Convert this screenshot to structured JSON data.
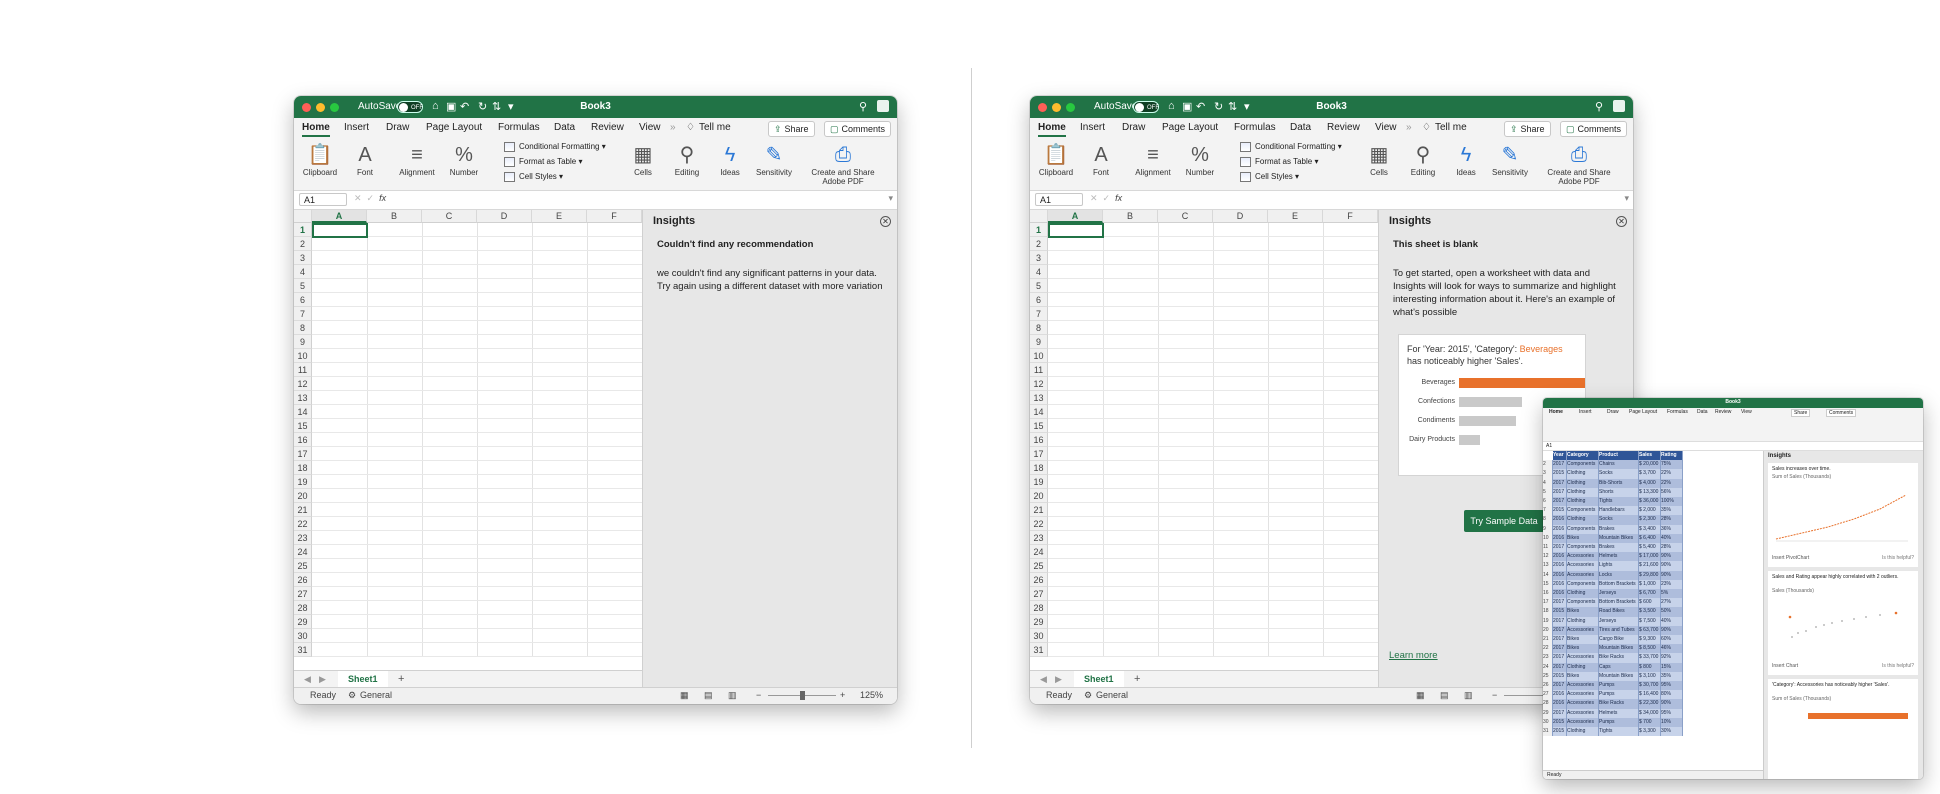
{
  "window": {
    "autosave_label": "AutoSave",
    "autosave_state": "OFF",
    "title": "Book3"
  },
  "tabs": [
    "Home",
    "Insert",
    "Draw",
    "Page Layout",
    "Formulas",
    "Data",
    "Review",
    "View"
  ],
  "tell_me": "Tell me",
  "share": "Share",
  "comments": "Comments",
  "ribbon": {
    "clipboard": "Clipboard",
    "font": "Font",
    "alignment": "Alignment",
    "number": "Number",
    "conditional_formatting": "Conditional Formatting",
    "format_as_table": "Format as Table",
    "cell_styles": "Cell Styles",
    "cells": "Cells",
    "editing": "Editing",
    "ideas": "Ideas",
    "sensitivity": "Sensitivity",
    "adobe_line1": "Create and Share",
    "adobe_line2": "Adobe PDF"
  },
  "name_box": "A1",
  "fx": "fx",
  "columns": [
    "A",
    "B",
    "C",
    "D",
    "E",
    "F"
  ],
  "rows": [
    "1",
    "2",
    "3",
    "4",
    "5",
    "6",
    "7",
    "8",
    "9",
    "10",
    "11",
    "12",
    "13",
    "14",
    "15",
    "16",
    "17",
    "18",
    "19",
    "20",
    "21",
    "22",
    "23",
    "24",
    "25",
    "26",
    "27",
    "28",
    "29",
    "30",
    "31"
  ],
  "sheet_tab": "Sheet1",
  "status": {
    "ready": "Ready",
    "general": "General",
    "zoom": "125%"
  },
  "left_panel": {
    "title": "Insights",
    "heading": "Couldn't find any recommendation",
    "body": "we couldn't find any significant patterns in your data. Try again using a different dataset with more variation"
  },
  "right_panel": {
    "title": "Insights",
    "heading": "This sheet is blank",
    "body": "To get started, open a worksheet with data and Insights will look for ways to summarize and highlight interesting information about it. Here's an example of what's possible",
    "example_prefix": "For 'Year: 2015', 'Category':",
    "example_highlight": "Beverages",
    "example_suffix": "has noticeably higher 'Sales'.",
    "bars": [
      {
        "label": "Beverages",
        "value": 1.0
      },
      {
        "label": "Confections",
        "value": 0.5
      },
      {
        "label": "Condiments",
        "value": 0.45
      },
      {
        "label": "Dairy Products",
        "value": 0.17
      }
    ],
    "try_button": "Try Sample Data",
    "learn_more": "Learn more"
  },
  "inset": {
    "insights_title": "Insights",
    "card1_text": "Sales increases over time.",
    "card1_sub": "Sum of Sales (Thousands)",
    "card1_link": "Insert PivotChart",
    "card2_text": "Sales and Rating appear highly correlated with 2 outliers.",
    "card2_sub": "Sales (Thousands)",
    "card2_link": "Insert Chart",
    "card3_text": "'Category': Accessories has noticeably higher 'Sales'.",
    "card3_sub": "Sum of Sales (Thousands)",
    "helpful": "Is this helpful?",
    "headers": [
      "Year",
      "Category",
      "Product",
      "Sales",
      "Rating"
    ],
    "table": [
      [
        "2017",
        "Components",
        "Chains",
        "$ 20,000",
        "75%"
      ],
      [
        "2015",
        "Clothing",
        "Socks",
        "$ 3,700",
        "22%"
      ],
      [
        "2017",
        "Clothing",
        "Bib-Shorts",
        "$ 4,000",
        "22%"
      ],
      [
        "2017",
        "Clothing",
        "Shorts",
        "$ 13,300",
        "56%"
      ],
      [
        "2017",
        "Clothing",
        "Tights",
        "$ 36,000",
        "100%"
      ],
      [
        "2015",
        "Components",
        "Handlebars",
        "$ 2,000",
        "35%"
      ],
      [
        "2016",
        "Clothing",
        "Socks",
        "$ 2,300",
        "28%"
      ],
      [
        "2016",
        "Components",
        "Brakes",
        "$ 3,400",
        "36%"
      ],
      [
        "2016",
        "Bikes",
        "Mountain Bikes",
        "$ 6,400",
        "40%"
      ],
      [
        "2017",
        "Components",
        "Brakes",
        "$ 5,400",
        "28%"
      ],
      [
        "2016",
        "Accessories",
        "Helmets",
        "$ 17,000",
        "90%"
      ],
      [
        "2016",
        "Accessories",
        "Lights",
        "$ 21,600",
        "90%"
      ],
      [
        "2016",
        "Accessories",
        "Locks",
        "$ 29,800",
        "90%"
      ],
      [
        "2016",
        "Components",
        "Bottom Brackets",
        "$ 1,000",
        "23%"
      ],
      [
        "2016",
        "Clothing",
        "Jerseys",
        "$ 6,700",
        "5%"
      ],
      [
        "2017",
        "Components",
        "Bottom Brackets",
        "$ 600",
        "27%"
      ],
      [
        "2015",
        "Bikes",
        "Road Bikes",
        "$ 3,500",
        "50%"
      ],
      [
        "2017",
        "Clothing",
        "Jerseys",
        "$ 7,500",
        "40%"
      ],
      [
        "2017",
        "Accessories",
        "Tires and Tubes",
        "$ 63,700",
        "90%"
      ],
      [
        "2017",
        "Bikes",
        "Cargo Bike",
        "$ 9,300",
        "60%"
      ],
      [
        "2017",
        "Bikes",
        "Mountain Bikes",
        "$ 8,500",
        "46%"
      ],
      [
        "2017",
        "Accessories",
        "Bike Racks",
        "$ 33,700",
        "92%"
      ],
      [
        "2017",
        "Clothing",
        "Caps",
        "$ 800",
        "15%"
      ],
      [
        "2015",
        "Bikes",
        "Mountain Bikes",
        "$ 3,100",
        "35%"
      ],
      [
        "2017",
        "Accessories",
        "Pumps",
        "$ 30,700",
        "95%"
      ],
      [
        "2016",
        "Accessories",
        "Pumps",
        "$ 16,400",
        "80%"
      ],
      [
        "2016",
        "Accessories",
        "Bike Racks",
        "$ 22,300",
        "90%"
      ],
      [
        "2017",
        "Accessories",
        "Helmets",
        "$ 34,000",
        "95%"
      ],
      [
        "2015",
        "Accessories",
        "Pumps",
        "$ 700",
        "10%"
      ],
      [
        "2015",
        "Clothing",
        "Tights",
        "$ 3,300",
        "30%"
      ]
    ]
  }
}
